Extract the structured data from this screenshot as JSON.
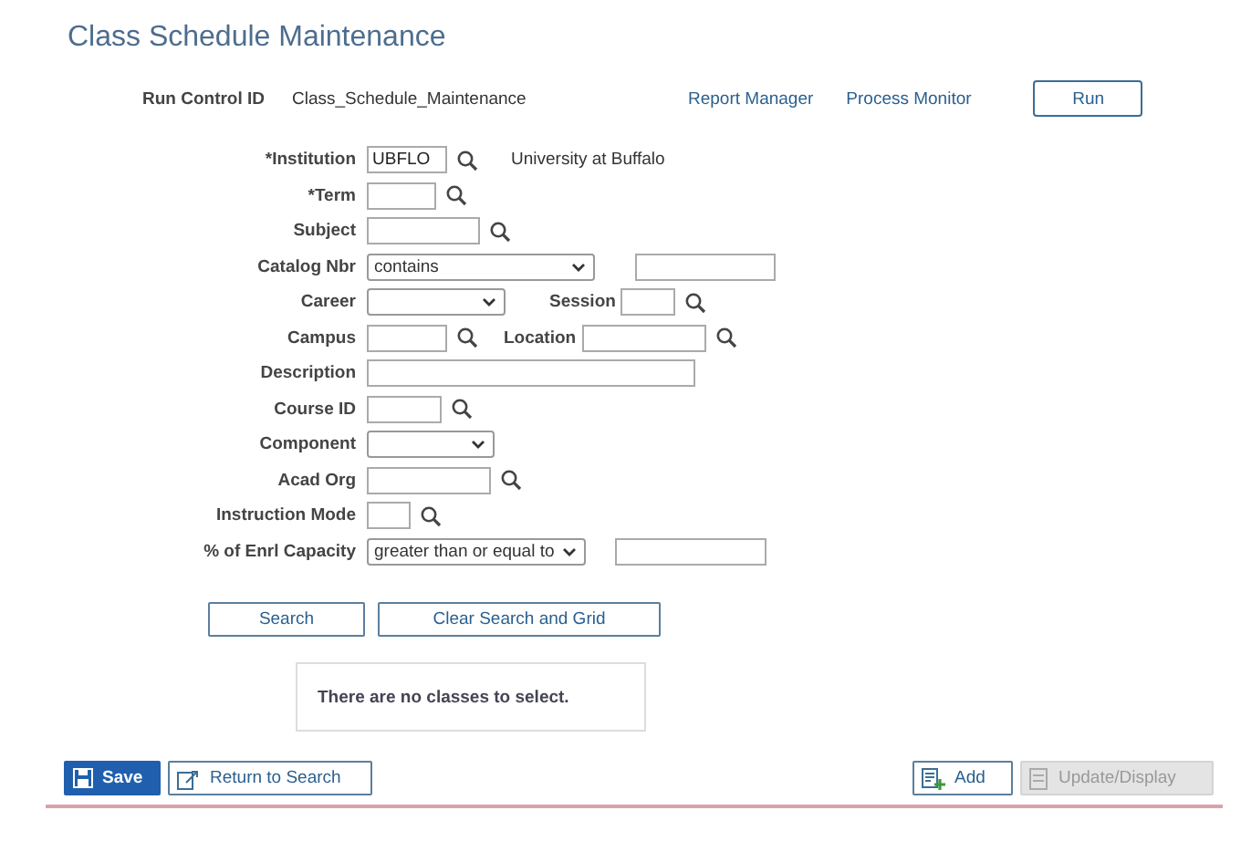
{
  "page_title": "Class Schedule Maintenance",
  "run_control": {
    "label": "Run Control ID",
    "value": "Class_Schedule_Maintenance",
    "links": [
      "Report Manager",
      "Process Monitor"
    ],
    "button": "Run"
  },
  "form_rows": [
    {
      "parts": [
        {
          "kind": "label",
          "text": "*Institution"
        },
        {
          "kind": "text",
          "value": "UBFLO",
          "lookup": true
        },
        {
          "kind": "note",
          "text": "University at Buffalo"
        }
      ]
    },
    {
      "parts": [
        {
          "kind": "label",
          "text": "*Term"
        },
        {
          "kind": "text",
          "lookup": true
        }
      ]
    },
    {
      "parts": [
        {
          "kind": "label",
          "text": "Subject"
        },
        {
          "kind": "text",
          "lookup": true
        }
      ]
    },
    {
      "parts": [
        {
          "kind": "label",
          "text": "Catalog Nbr"
        },
        {
          "kind": "select",
          "value": "contains"
        },
        {
          "kind": "text",
          "lookup": false
        }
      ]
    },
    {
      "parts": [
        {
          "kind": "label",
          "text": "Career"
        },
        {
          "kind": "select"
        },
        {
          "kind": "label",
          "text": "Session"
        },
        {
          "kind": "text",
          "lookup": true
        }
      ]
    },
    {
      "parts": [
        {
          "kind": "label",
          "text": "Campus"
        },
        {
          "kind": "text",
          "lookup": true
        },
        {
          "kind": "label",
          "text": "Location"
        },
        {
          "kind": "text",
          "lookup": true
        }
      ]
    },
    {
      "parts": [
        {
          "kind": "label",
          "text": "Description"
        },
        {
          "kind": "text",
          "lookup": false
        }
      ]
    },
    {
      "parts": [
        {
          "kind": "label",
          "text": "Course ID"
        },
        {
          "kind": "text",
          "lookup": true
        }
      ]
    },
    {
      "parts": [
        {
          "kind": "label",
          "text": "Component"
        },
        {
          "kind": "select"
        }
      ]
    },
    {
      "parts": [
        {
          "kind": "label",
          "text": "Acad Org"
        },
        {
          "kind": "text",
          "lookup": true
        }
      ]
    },
    {
      "parts": [
        {
          "kind": "label",
          "text": "Instruction Mode"
        },
        {
          "kind": "text",
          "lookup": true
        }
      ]
    },
    {
      "parts": [
        {
          "kind": "label",
          "text": "% of Enrl Capacity"
        },
        {
          "kind": "select",
          "value": "greater than or equal to"
        },
        {
          "kind": "text",
          "lookup": false
        }
      ]
    }
  ],
  "search_buttons": [
    "Search",
    "Clear Search and Grid"
  ],
  "message": "There are no classes to select.",
  "toolbar": [
    {
      "label": "Save",
      "kind": "primary",
      "disabled": false
    },
    {
      "label": "Return to Search",
      "kind": "secondary",
      "disabled": false
    },
    {
      "label": "Add",
      "kind": "secondary",
      "disabled": false
    },
    {
      "label": "Update/Display",
      "kind": "secondary",
      "disabled": true
    }
  ]
}
